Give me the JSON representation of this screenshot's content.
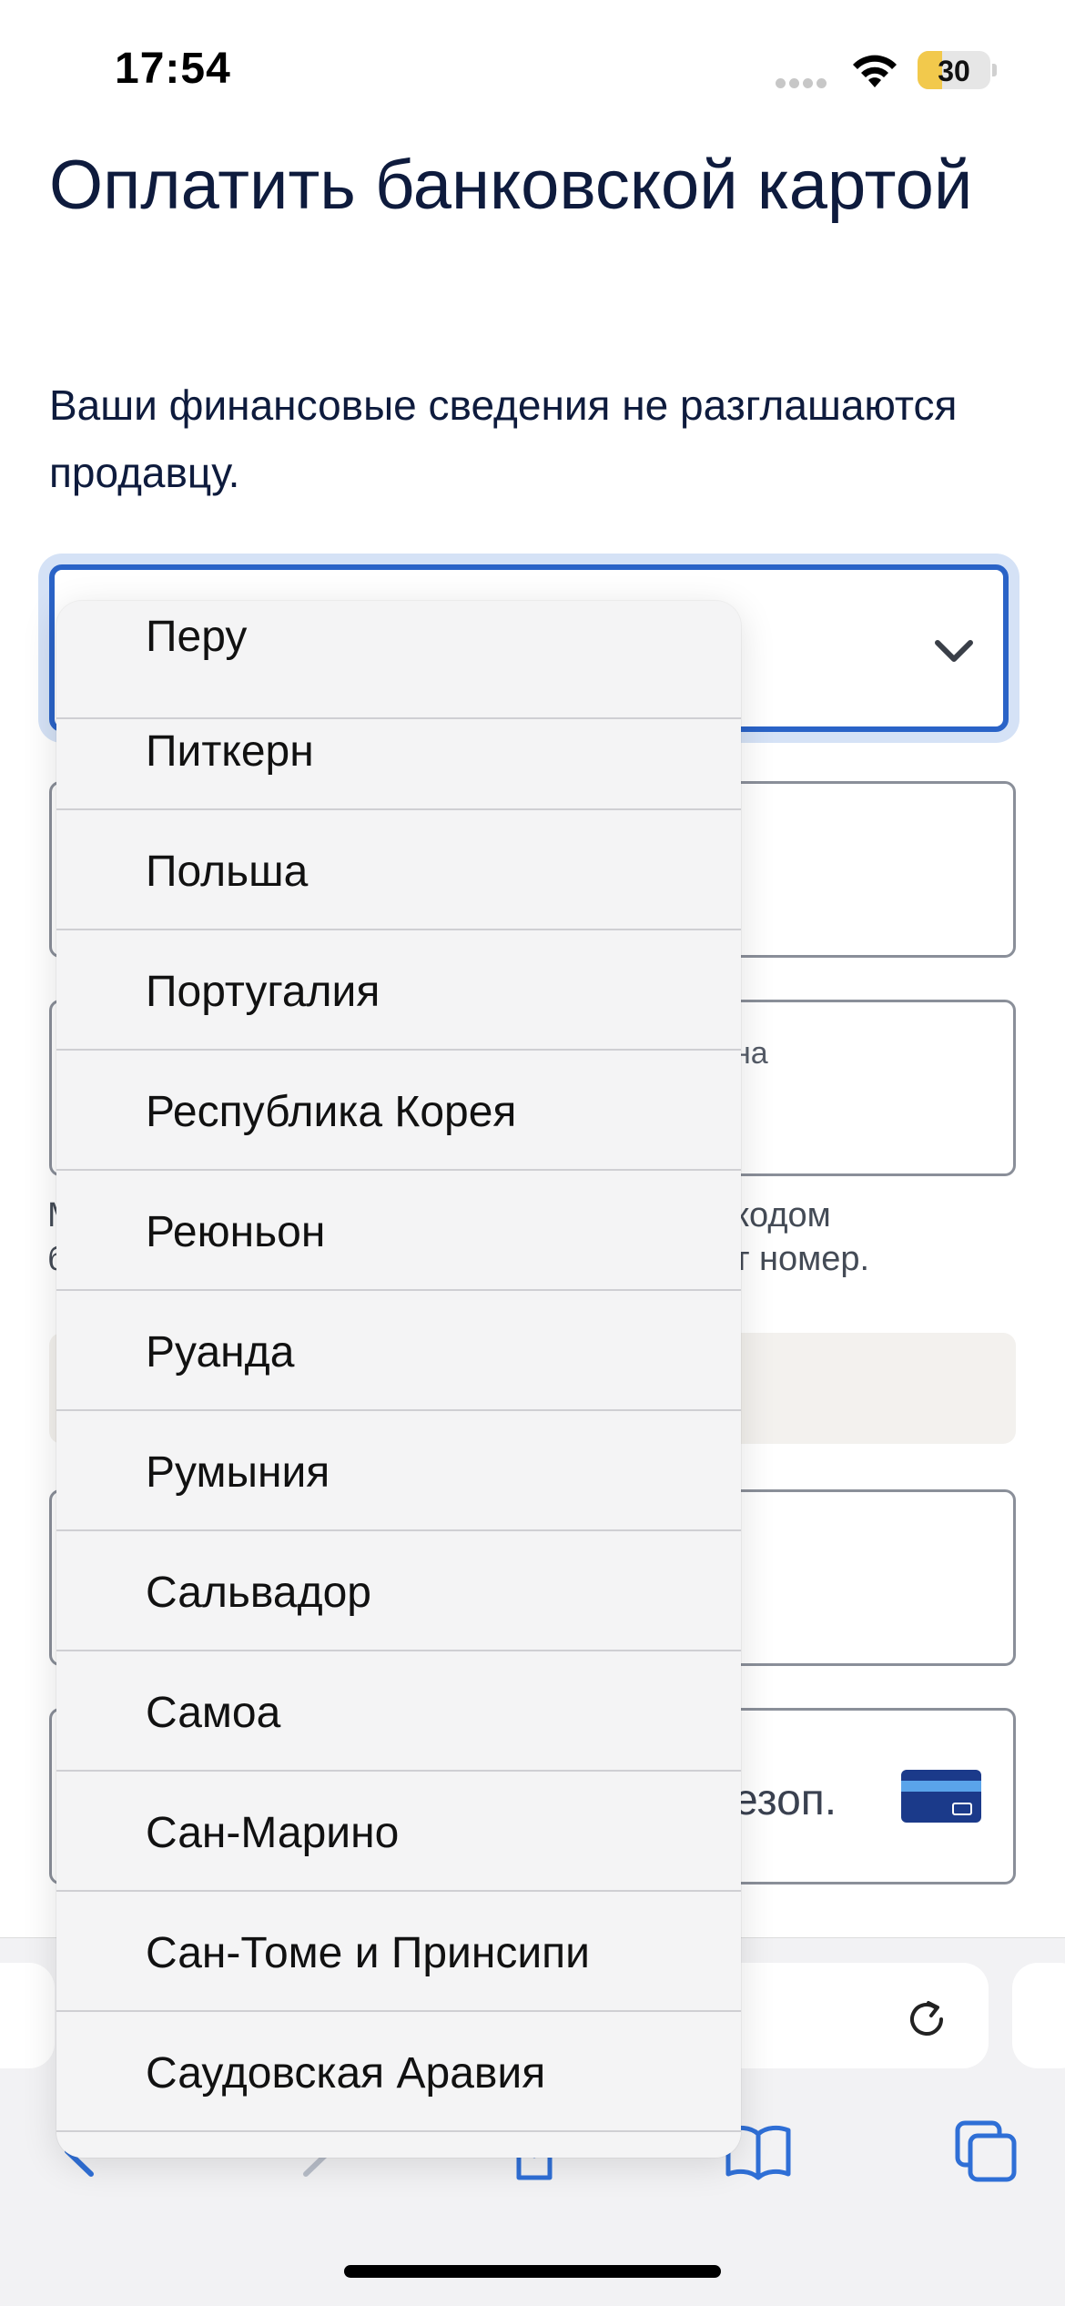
{
  "status_bar": {
    "time": "17:54",
    "battery_level": "30",
    "battery_color": "#f2c94c"
  },
  "page": {
    "title": "Оплатить банковской картой",
    "subtitle": "Ваши финансовые сведения не разглашаются продавцу.",
    "field2_label_fragment": "на",
    "hint_line1_start": "М",
    "hint_line2_start": "б",
    "hint_line1_end": "кодом",
    "hint_line2_end": "т номер.",
    "field4_label_fragment": "езоп.",
    "accent_color": "#2a63c7"
  },
  "dropdown": {
    "options": [
      "Перу",
      "Питкерн",
      "Польша",
      "Португалия",
      "Республика Корея",
      "Реюньон",
      "Руанда",
      "Румыния",
      "Сальвадор",
      "Самоа",
      "Сан-Марино",
      "Сан-Томе и Принсипи",
      "Саудовская Аравия"
    ]
  },
  "icons": {
    "select_chevron": "chevron-down-icon",
    "card": "credit-card-icon",
    "reload": "reload-icon",
    "back": "back-arrow-icon",
    "forward": "forward-arrow-icon",
    "share": "share-icon",
    "bookmarks": "bookmarks-icon",
    "tabs": "tabs-icon"
  }
}
